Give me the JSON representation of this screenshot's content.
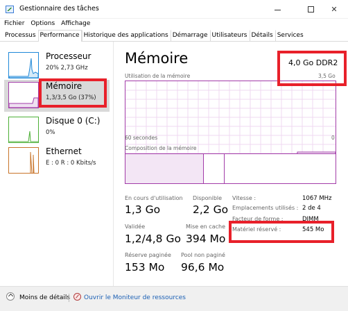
{
  "window": {
    "title": "Gestionnaire des tâches"
  },
  "menu": [
    "Fichier",
    "Options",
    "Affichage"
  ],
  "tabs": [
    "Processus",
    "Performance",
    "Historique des applications",
    "Démarrage",
    "Utilisateurs",
    "Détails",
    "Services"
  ],
  "active_tab": "Performance",
  "sidebar": [
    {
      "name": "Processeur",
      "sub": "20%  2,73 GHz",
      "color": "#1e88d8"
    },
    {
      "name": "Mémoire",
      "sub": "1,3/3,5 Go (37%)",
      "color": "#a23ba8"
    },
    {
      "name": "Disque 0 (C:)",
      "sub": "0%",
      "color": "#4caf36"
    },
    {
      "name": "Ethernet",
      "sub": "E : 0  R : 0 Kbits/s",
      "color": "#c8742a"
    }
  ],
  "memory": {
    "title": "Mémoire",
    "type": "4,0 Go DDR2",
    "usage_label": "Utilisation de la mémoire",
    "usage_max": "3,5 Go",
    "time_label": "60 secondes",
    "zero_label": "0",
    "composition_label": "Composition de la mémoire",
    "accent": "#a23ba8",
    "usage_fraction": 0.37,
    "stats": {
      "in_use_label": "En cours d'utilisation",
      "in_use": "1,3 Go",
      "available_label": "Disponible",
      "available": "2,2 Go",
      "committed_label": "Validée",
      "committed": "1,2/4,8 Go",
      "cached_label": "Mise en cache",
      "cached": "394 Mo",
      "paged_label": "Réserve paginée",
      "paged": "153 Mo",
      "nonpaged_label": "Pool non paginé",
      "nonpaged": "96,6 Mo"
    },
    "specs": {
      "speed_label": "Vitesse :",
      "speed": "1067 MHz",
      "slots_label": "Emplacements utilisés :",
      "slots": "2 de 4",
      "form_label": "Facteur de forme :",
      "form": "DIMM",
      "reserved_label": "Matériel réservé :",
      "reserved": "545 Mo"
    }
  },
  "footer": {
    "less_details": "Moins de détails",
    "resource_monitor": "Ouvrir le Moniteur de ressources"
  }
}
